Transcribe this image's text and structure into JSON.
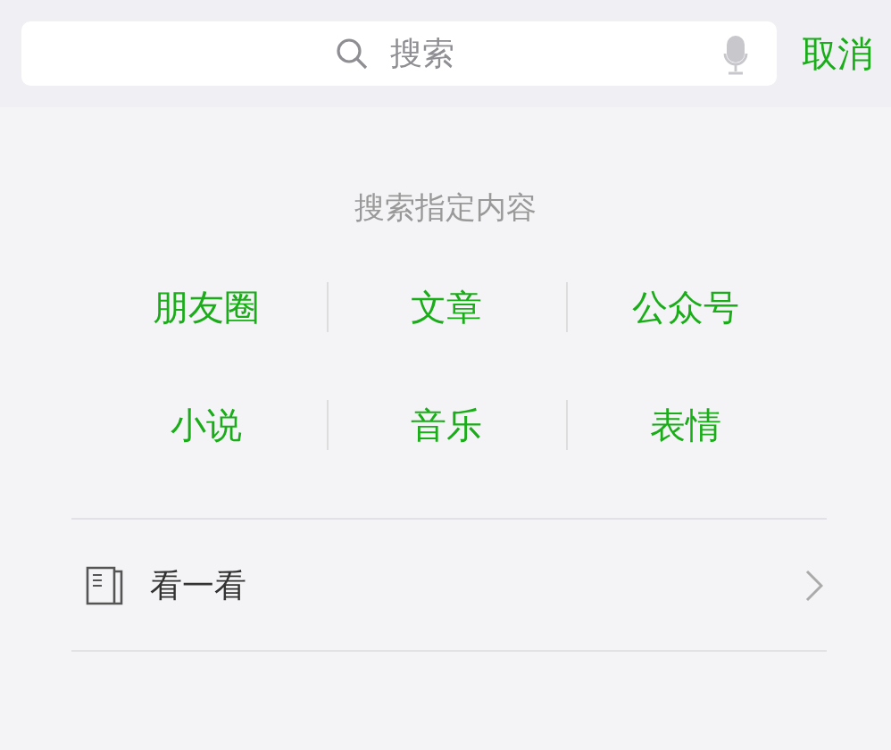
{
  "search": {
    "placeholder": "搜索",
    "cancel": "取消"
  },
  "section": {
    "title": "搜索指定内容",
    "categories": [
      "朋友圈",
      "文章",
      "公众号",
      "小说",
      "音乐",
      "表情"
    ]
  },
  "list": [
    {
      "label": "看一看"
    }
  ]
}
